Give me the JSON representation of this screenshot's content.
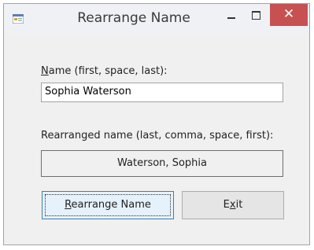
{
  "window": {
    "title": "Rearrange Name",
    "icon": "windows-form-icon",
    "controls": {
      "minimize": "minimize-icon",
      "maximize": "maximize-icon",
      "close_glyph": "✕"
    }
  },
  "form": {
    "name_label_accel": "N",
    "name_label_rest": "ame (first, space, last):",
    "name_value": "Sophia Waterson",
    "result_label": "Rearranged name (last, comma, space, first):",
    "result_value": "Waterson, Sophia",
    "rearrange_button_accel": "R",
    "rearrange_button_rest": "earrange Name",
    "exit_button_pre": "E",
    "exit_button_accel": "x",
    "exit_button_post": "it"
  },
  "colors": {
    "close_button": "#c75050",
    "default_button_border": "#3c7fb1",
    "window_background": "#f0f0f0"
  }
}
